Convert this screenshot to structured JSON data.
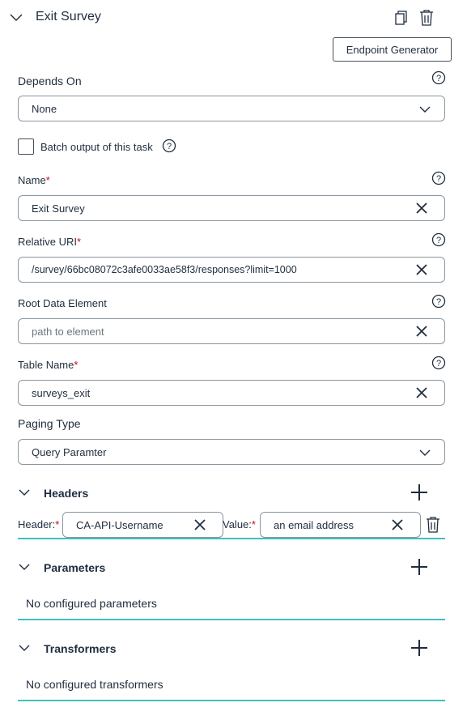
{
  "header": {
    "title": "Exit Survey",
    "endpoint_button": "Endpoint Generator"
  },
  "depends_on": {
    "label": "Depends On",
    "value": "None"
  },
  "batch": {
    "label": "Batch output of this task"
  },
  "name": {
    "label": "Name",
    "required": "*",
    "value": "Exit Survey"
  },
  "relative_uri": {
    "label": "Relative URI",
    "required": "*",
    "value": "/survey/66bc08072c3afe0033ae58f3/responses?limit=1000"
  },
  "root_data": {
    "label": "Root Data Element",
    "placeholder": "path to element"
  },
  "table_name": {
    "label": "Table Name",
    "required": "*",
    "value": "surveys_exit"
  },
  "paging": {
    "label": "Paging Type",
    "value": "Query Paramter"
  },
  "headers": {
    "title": "Headers",
    "header_label": "Header:",
    "required": "*",
    "header_value": "CA-API-Username",
    "value_label": "Value:",
    "value_value": "an email address"
  },
  "parameters": {
    "title": "Parameters",
    "empty": "No configured parameters"
  },
  "transformers": {
    "title": "Transformers",
    "empty": "No configured transformers"
  },
  "colors": {
    "accent": "#3fbfc4",
    "required": "#d0021b",
    "text": "#1f2d3d"
  }
}
